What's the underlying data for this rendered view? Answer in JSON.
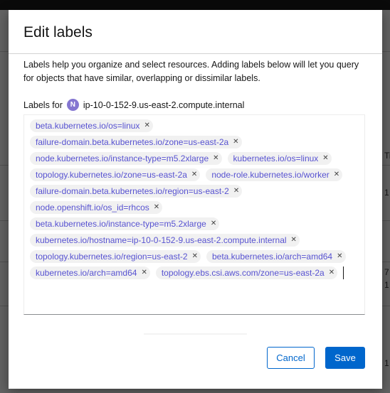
{
  "modal": {
    "title": "Edit labels",
    "description": "Labels help you organize and select resources. Adding labels below will let you query for objects that have similar, overlapping or dissimilar labels.",
    "labels_for_prefix": "Labels for",
    "node_badge": "N",
    "node_name": "ip-10-0-152-9.us-east-2.compute.internal",
    "labels": [
      "beta.kubernetes.io/os=linux",
      "failure-domain.beta.kubernetes.io/zone=us-east-2a",
      "node.kubernetes.io/instance-type=m5.2xlarge",
      "kubernetes.io/os=linux",
      "topology.kubernetes.io/zone=us-east-2a",
      "node-role.kubernetes.io/worker",
      "failure-domain.beta.kubernetes.io/region=us-east-2",
      "node.openshift.io/os_id=rhcos",
      "beta.kubernetes.io/instance-type=m5.2xlarge",
      "kubernetes.io/hostname=ip-10-0-152-9.us-east-2.compute.internal",
      "topology.kubernetes.io/region=us-east-2",
      "beta.kubernetes.io/arch=amd64",
      "kubernetes.io/arch=amd64",
      "topology.ebs.csi.aws.com/zone=us-east-2a"
    ],
    "tag_close_glyph": "✕",
    "cancel_label": "Cancel",
    "save_label": "Save"
  },
  "background": {
    "edge_texts": [
      "Ti",
      "1",
      "7",
      "1",
      "1"
    ]
  },
  "colors": {
    "primary": "#0066cc",
    "label_text": "#5752d1",
    "node_badge": "#8476d1",
    "overlay": "rgba(3,3,3,0.62)"
  },
  "icons": {
    "node_badge": "node-badge-icon",
    "tag_close": "close-icon"
  }
}
